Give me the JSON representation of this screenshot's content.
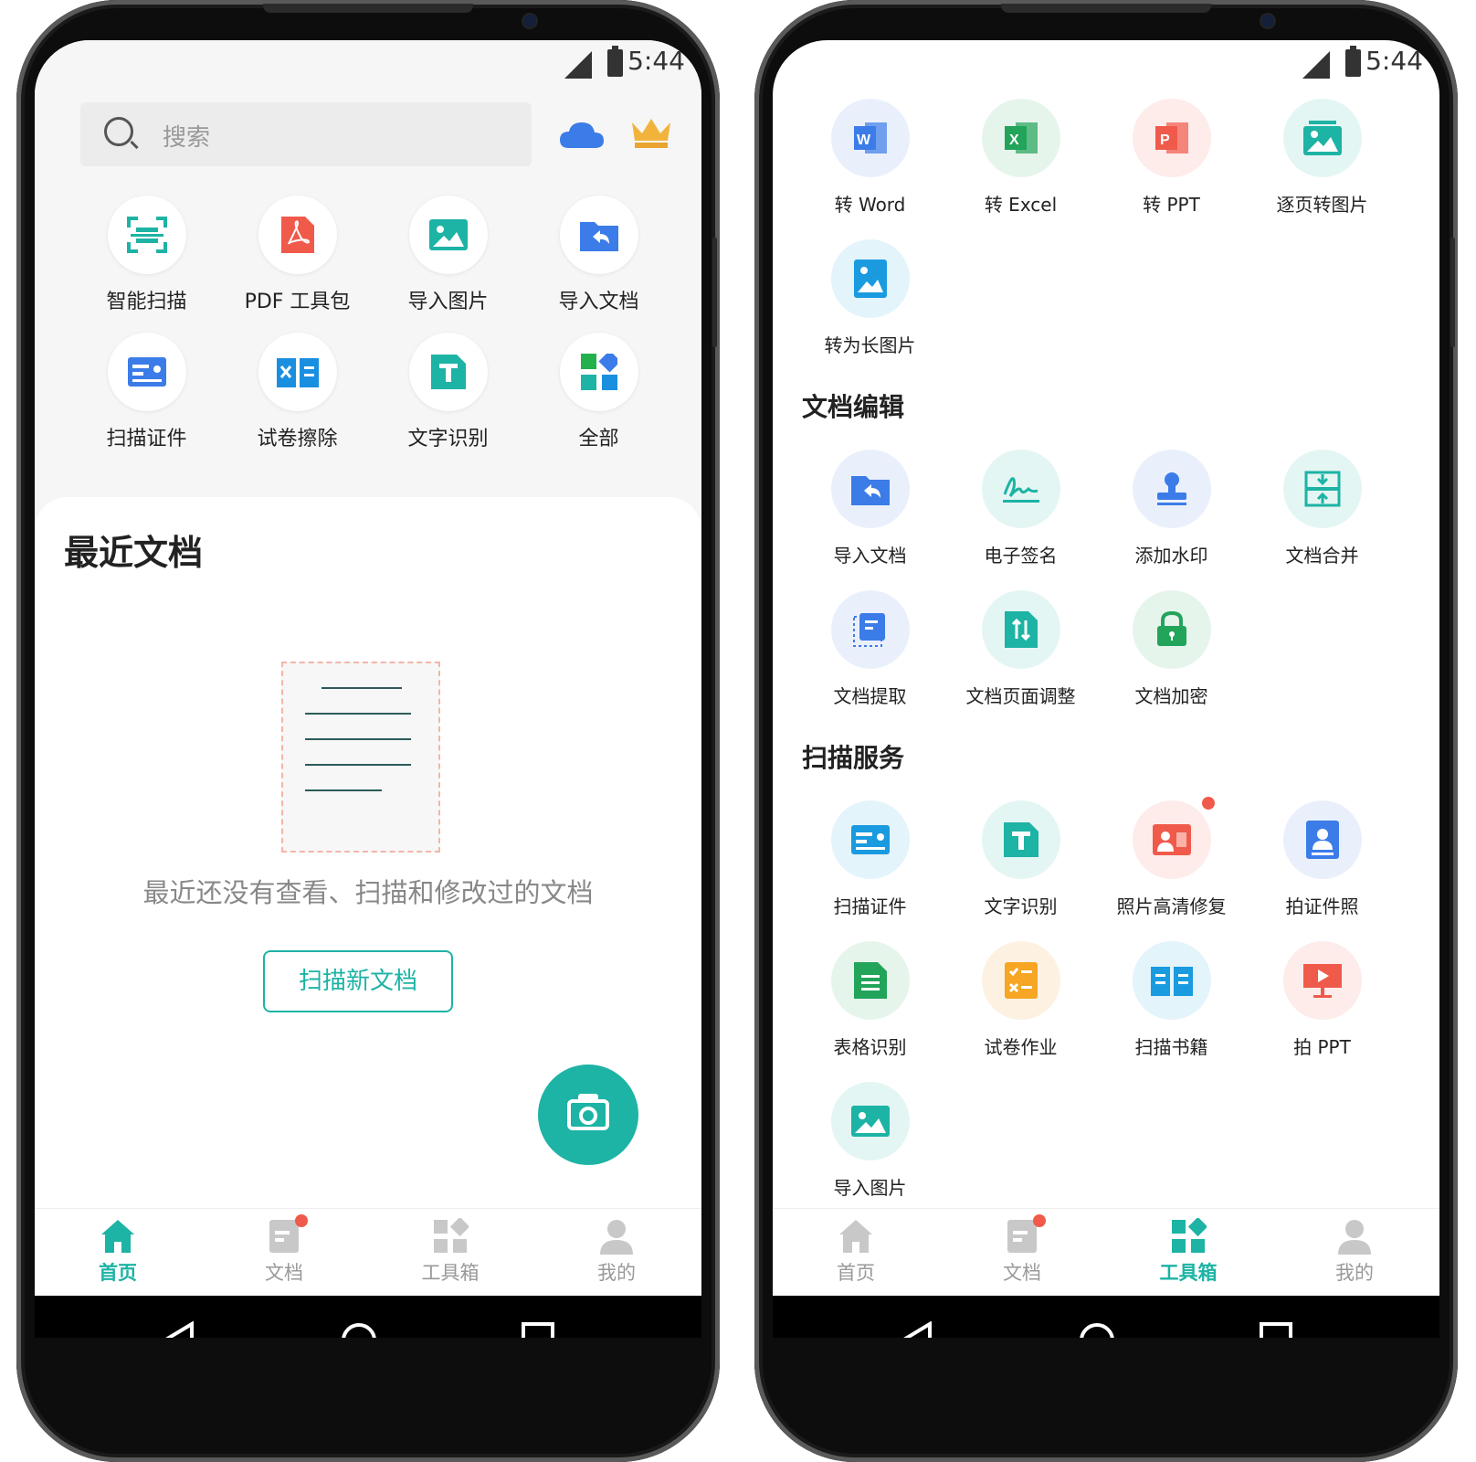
{
  "status": {
    "time": "5:44"
  },
  "home": {
    "search_placeholder": "搜索",
    "quick_actions": [
      {
        "label": "智能扫描",
        "icon": "scan-frame-icon"
      },
      {
        "label": "PDF 工具包",
        "icon": "pdf-icon"
      },
      {
        "label": "导入图片",
        "icon": "image-icon"
      },
      {
        "label": "导入文档",
        "icon": "folder-import-icon"
      },
      {
        "label": "扫描证件",
        "icon": "id-card-icon"
      },
      {
        "label": "试卷擦除",
        "icon": "erase-icon"
      },
      {
        "label": "文字识别",
        "icon": "text-t-icon"
      },
      {
        "label": "全部",
        "icon": "grid-apps-icon"
      }
    ],
    "recent_title": "最近文档",
    "empty_message": "最近还没有查看、扫描和修改过的文档",
    "scan_new_label": "扫描新文档"
  },
  "tabbar": {
    "tabs": [
      {
        "label": "首页",
        "icon": "home-icon"
      },
      {
        "label": "文档",
        "icon": "document-icon"
      },
      {
        "label": "工具箱",
        "icon": "toolbox-icon"
      },
      {
        "label": "我的",
        "icon": "profile-icon"
      }
    ]
  },
  "tools": {
    "convert_items": [
      {
        "label": "转 Word",
        "icon": "word-icon"
      },
      {
        "label": "转 Excel",
        "icon": "excel-icon"
      },
      {
        "label": "转 PPT",
        "icon": "ppt-icon"
      },
      {
        "label": "逐页转图片",
        "icon": "page-image-icon"
      },
      {
        "label": "转为长图片",
        "icon": "long-image-icon"
      }
    ],
    "section_edit": "文档编辑",
    "edit_items": [
      {
        "label": "导入文档",
        "icon": "folder-import-icon"
      },
      {
        "label": "电子签名",
        "icon": "signature-icon"
      },
      {
        "label": "添加水印",
        "icon": "stamp-icon"
      },
      {
        "label": "文档合并",
        "icon": "merge-icon"
      },
      {
        "label": "文档提取",
        "icon": "extract-icon"
      },
      {
        "label": "文档页面调整",
        "icon": "page-adjust-icon"
      },
      {
        "label": "文档加密",
        "icon": "lock-icon"
      }
    ],
    "section_scan": "扫描服务",
    "scan_items": [
      {
        "label": "扫描证件",
        "icon": "id-card-icon"
      },
      {
        "label": "文字识别",
        "icon": "text-t-icon"
      },
      {
        "label": "照片高清修复",
        "icon": "photo-repair-icon"
      },
      {
        "label": "拍证件照",
        "icon": "id-photo-icon"
      },
      {
        "label": "表格识别",
        "icon": "table-icon"
      },
      {
        "label": "试卷作业",
        "icon": "exam-icon"
      },
      {
        "label": "扫描书籍",
        "icon": "book-icon"
      },
      {
        "label": "拍 PPT",
        "icon": "projector-icon"
      },
      {
        "label": "导入图片",
        "icon": "image-icon"
      }
    ]
  },
  "colors": {
    "accent": "#1db3a5",
    "blue": "#3b7ce8",
    "red": "#f05a4b",
    "orange": "#f6a623"
  }
}
